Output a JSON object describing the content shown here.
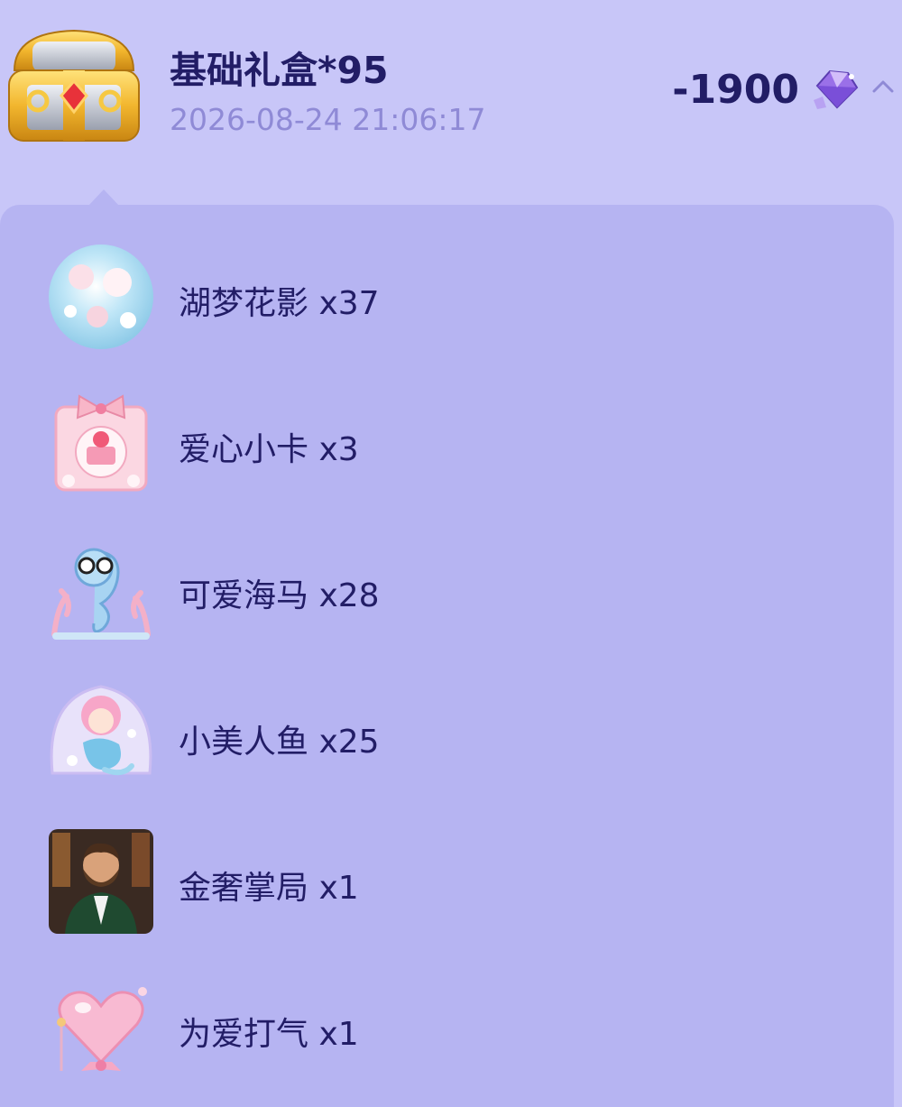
{
  "record": {
    "title": "基础礼盒*95",
    "timestamp": "2026-08-24 21:06:17",
    "amount": "-1900",
    "box_icon": "treasure-chest-icon",
    "currency_icon": "purple-gem-icon",
    "expand_icon": "chevron-up-icon"
  },
  "gifts": [
    {
      "label": "湖梦花影 x37",
      "icon": "flower-bubble-orb-icon"
    },
    {
      "label": "爱心小卡 x3",
      "icon": "pink-bow-card-icon"
    },
    {
      "label": "可爱海马 x28",
      "icon": "seahorse-icon"
    },
    {
      "label": "小美人鱼 x25",
      "icon": "mermaid-icon"
    },
    {
      "label": "金奢掌局 x1",
      "icon": "gentleman-portrait-icon"
    },
    {
      "label": "为爱打气 x1",
      "icon": "pink-heart-balloon-icon"
    }
  ],
  "colors": {
    "background": "#c8c6f8",
    "panel": "#b6b4f2",
    "text_primary": "#221d66",
    "text_secondary": "#8f8ad6"
  }
}
